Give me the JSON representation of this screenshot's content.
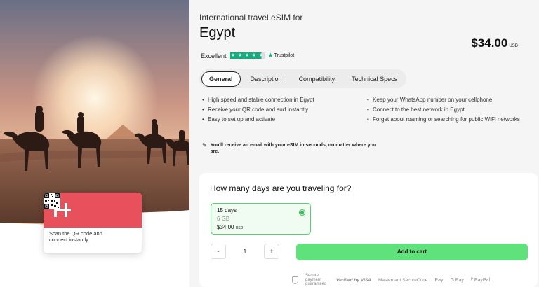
{
  "hero": {
    "card": {
      "scan_text": "Scan the QR code and connect instantly."
    }
  },
  "product": {
    "subtitle": "International travel eSIM for",
    "country": "Egypt",
    "price": "$34.00",
    "currency": "USD"
  },
  "rating": {
    "label": "Excellent",
    "stars_value": 4.5,
    "provider": "Trustpilot"
  },
  "tabs": [
    {
      "label": "General",
      "active": true
    },
    {
      "label": "Description",
      "active": false
    },
    {
      "label": "Compatibility",
      "active": false
    },
    {
      "label": "Technical Specs",
      "active": false
    }
  ],
  "features": {
    "left": [
      "High speed and stable connection in Egypt",
      "Receive your QR code and surf instantly",
      "Easy to set up and activate"
    ],
    "right": [
      "Keep your WhatsApp number on your cellphone",
      "Connect to the best network in Egypt",
      "Forget about roaming or searching for public WiFi networks"
    ]
  },
  "note": "You'll receive an email with your eSIM in seconds, no matter where you are.",
  "booking": {
    "question": "How many days are you traveling for?",
    "plan": {
      "days": "15 days",
      "data": "6 GB",
      "price": "$34.00",
      "currency": "USD",
      "selected": true
    },
    "quantity": "1",
    "minus": "-",
    "plus": "+",
    "cart_label": "Add to cart"
  },
  "payments": {
    "secure_label": "Secure payment guaranteed",
    "visa_label": "Verified by VISA",
    "mastercard_label": "Mastercard SecureCode",
    "apple_pay": "Pay",
    "google_pay": "G Pay",
    "paypal": "PayPal"
  },
  "colors": {
    "brand_red": "#e8505b",
    "cart_green": "#5fe17c",
    "trustpilot_green": "#00b67a"
  }
}
